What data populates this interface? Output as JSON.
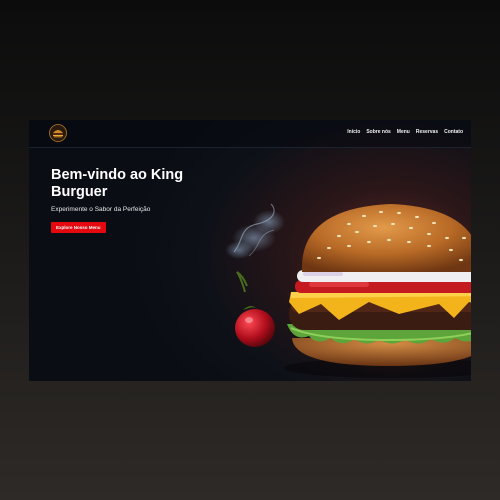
{
  "nav": {
    "logo": "King Burguer logo",
    "links": [
      "Início",
      "Sobre nós",
      "Menu",
      "Reservas",
      "Contato"
    ]
  },
  "hero": {
    "title": "Bem-vindo ao King Burguer",
    "subtitle": "Experimente o Sabor da Perfeição",
    "cta_label": "Explore Nosso Menu"
  },
  "colors": {
    "accent": "#e5090f",
    "background": "#0a0d14"
  },
  "icons": {
    "logo": "burger-logo-icon"
  }
}
